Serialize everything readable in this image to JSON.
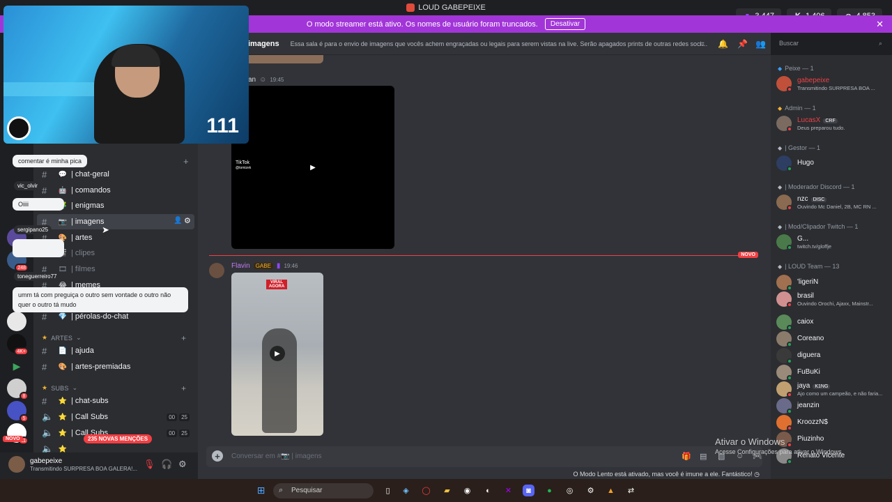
{
  "window": {
    "title": "LOUD GABEPEIXE"
  },
  "counters": [
    {
      "icon": "twitch-icon",
      "value": "3.447",
      "color": "#9146ff"
    },
    {
      "icon": "kick-icon",
      "value": "1.406",
      "color": "#53fc18"
    },
    {
      "icon": "globe-icon",
      "value": "4.853",
      "color": "#ffffff"
    }
  ],
  "banner": {
    "text": "O modo streamer está ativo. Os nomes de usuário foram truncados.",
    "button": "Desativar",
    "color": "#a235d8"
  },
  "webcam": {
    "number": "111"
  },
  "overlay_chat": [
    {
      "user": "",
      "text": "comentar é minha pica"
    },
    {
      "user": "vic_olvir",
      "text": ""
    },
    {
      "user": "",
      "text": "Oiiii"
    },
    {
      "user": "sergipano25",
      "text": ""
    },
    {
      "user": "toneguerreiro77",
      "text": ""
    },
    {
      "user": "",
      "text": "umm tá com preguiça o outro sem vontade o outro não quer o outro tá mudo"
    }
  ],
  "sidebar": {
    "channels": [
      {
        "emoji": "💬",
        "name": "| chat-geral",
        "muted": false
      },
      {
        "emoji": "🤖",
        "name": "| comandos",
        "muted": false
      },
      {
        "emoji": "🧩",
        "name": "| enigmas",
        "muted": false
      },
      {
        "emoji": "📷",
        "name": "| imagens",
        "muted": false,
        "active": true
      },
      {
        "emoji": "🎨",
        "name": "| artes",
        "muted": false
      },
      {
        "emoji": "🎬",
        "name": "| clipes",
        "muted": true
      },
      {
        "emoji": "🎞",
        "name": "| filmes",
        "muted": true
      },
      {
        "emoji": "😂",
        "name": "| memes",
        "muted": false
      },
      {
        "emoji": "💎",
        "name": "| pérolas-do-chat",
        "muted": false
      }
    ],
    "categories": [
      {
        "label": "ARTES",
        "channels": [
          {
            "emoji": "📄",
            "name": "| ajuda"
          },
          {
            "emoji": "🎨",
            "name": "| artes-premiadas"
          }
        ]
      },
      {
        "label": "SUBS",
        "channels": [
          {
            "emoji": "⭐",
            "name": "| chat-subs",
            "voice": false
          },
          {
            "emoji": "⭐",
            "name": "| Call Subs",
            "voice": true,
            "counts": [
              "00",
              "25"
            ]
          },
          {
            "emoji": "⭐",
            "name": "| Call Subs",
            "voice": true,
            "counts": [
              "00",
              "25"
            ]
          }
        ]
      }
    ],
    "mentions_badge": "235 NOVAS MENÇÕES",
    "new_badge": "NOVO"
  },
  "guild_badges": [
    "81",
    "248",
    "4K+",
    "8",
    "5",
    "11"
  ],
  "user_panel": {
    "name": "gabepeixe",
    "status": "Transmitindo SURPRESA BOA GALERA!..."
  },
  "channel": {
    "name": "imagens",
    "topic": "Essa sala é para o envio de imagens que vocês achem engraçadas ou legais para serem vistas na live. Serão apagados prints de outras redes sociais c..."
  },
  "search": {
    "placeholder": "Buscar"
  },
  "messages": [
    {
      "author": "an",
      "time": "19:45",
      "embed": "TikTok",
      "embed_handle": "@tomizek"
    },
    {
      "author": "Flavin",
      "role": "GABE",
      "time": "19:46",
      "image_text": "VIRAL AGORA"
    }
  ],
  "new_divider": "NOVO",
  "composer": {
    "placeholder": "Conversar em #📷 | imagens"
  },
  "slowmode": "O Modo Lento está ativado, mas você é imune a ele. Fantástico!",
  "activation": {
    "title": "Ativar o Windows",
    "subtitle": "Acesse Configurações para ativar o Windows."
  },
  "members": {
    "groups": [
      {
        "label": "Peixe — 1",
        "members": [
          {
            "name": "gabepeixe",
            "activity": "Transmitindo SURPRESA BOA ...",
            "color": "#ed4245",
            "tag": ""
          }
        ]
      },
      {
        "label": "Admin — 1",
        "members": [
          {
            "name": "LucasX",
            "activity": "Deus preparou tudo.",
            "color": "#ed4245",
            "tag": "CRF"
          }
        ]
      },
      {
        "label": "| Gestor — 1",
        "members": [
          {
            "name": "Hugo",
            "activity": "",
            "color": "#f2f3f5",
            "tag": ""
          }
        ]
      },
      {
        "label": "| Moderador Discord — 1",
        "members": [
          {
            "name": "nzc",
            "activity": "Ouvindo Mc Daniel, 2B, MC RN ...",
            "color": "#f2f3f5",
            "tag": "DISC"
          }
        ]
      },
      {
        "label": "| Mod/Clipador Twitch — 1",
        "members": [
          {
            "name": "G...",
            "activity": "twitch.tv/gloffje",
            "color": "#f2f3f5",
            "tag": ""
          }
        ]
      },
      {
        "label": "| LOUD Team — 13",
        "members": [
          {
            "name": "'ligeriN",
            "activity": "",
            "color": "#f2f3f5",
            "tag": ""
          },
          {
            "name": "brasil",
            "activity": "Ouvindo Orochi, Ajaxx, Mainstr...",
            "color": "#f2f3f5",
            "tag": ""
          },
          {
            "name": "caiox",
            "activity": "",
            "color": "#f2f3f5",
            "tag": ""
          },
          {
            "name": "Coreano",
            "activity": "",
            "color": "#f2f3f5",
            "tag": ""
          },
          {
            "name": "diguera",
            "activity": "",
            "color": "#f2f3f5",
            "tag": ""
          },
          {
            "name": "FuBuKi",
            "activity": "",
            "color": "#f2f3f5",
            "tag": ""
          },
          {
            "name": "jaya",
            "activity": "Ajo como um campeão, e não faria...",
            "color": "#f2f3f5",
            "tag": "K1NG"
          },
          {
            "name": "jeanzin",
            "activity": "",
            "color": "#f2f3f5",
            "tag": ""
          },
          {
            "name": "KroozzN$",
            "activity": "",
            "color": "#f2f3f5",
            "tag": ""
          },
          {
            "name": "Piuzinho",
            "activity": "",
            "color": "#f2f3f5",
            "tag": ""
          },
          {
            "name": "Renato Vicente",
            "activity": "",
            "color": "#f2f3f5",
            "tag": ""
          }
        ]
      }
    ]
  },
  "taskbar": {
    "search_placeholder": "Pesquisar"
  }
}
